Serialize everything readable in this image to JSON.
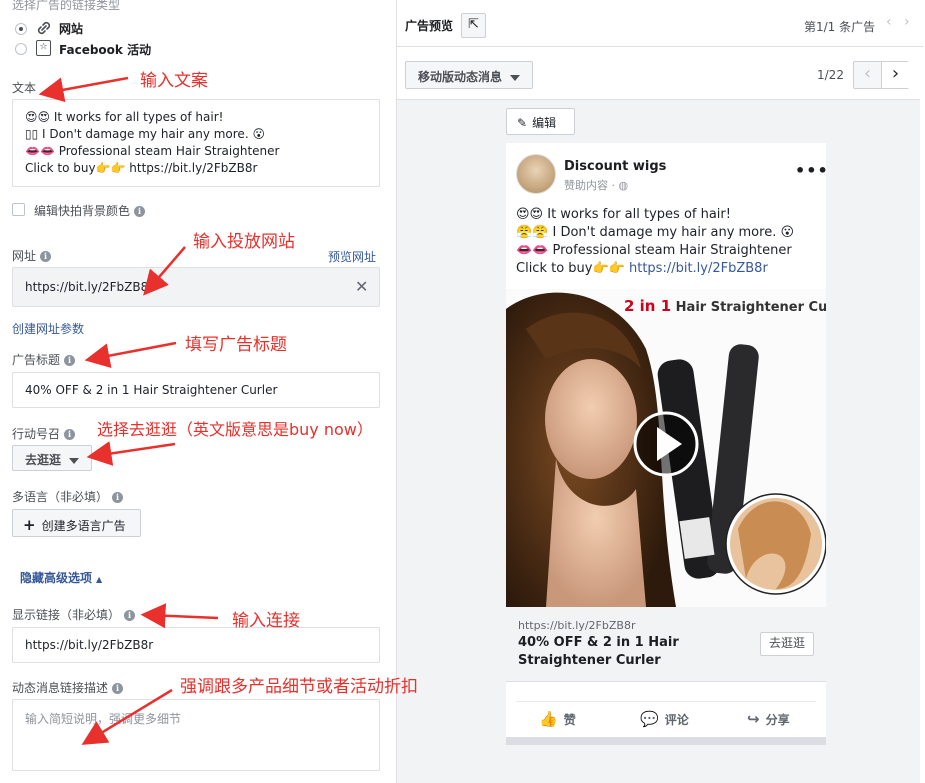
{
  "left": {
    "link_type_label": "选择广告的链接类型",
    "option_website": "网站",
    "option_facebook_event": "Facebook 活动",
    "text_label": "文本",
    "text_lines": [
      "😍😍 It works for all types of hair!",
      "▯▯ I Don't damage my hair any more. 😮",
      "👄👄 Professional steam Hair Straightener",
      "Click to buy👉👉 https://bit.ly/2FbZB8r"
    ],
    "edit_bg_color": "编辑快拍背景颜色",
    "url_label": "网址",
    "preview_url": "预览网址",
    "url_value": "https://bit.ly/2FbZB8r",
    "create_url_params": "创建网址参数",
    "headline_label": "广告标题",
    "headline_value": "40% OFF & 2 in 1 Hair Straightener Curler",
    "cta_label": "行动号召",
    "cta_value": "去逛逛",
    "multilang_label": "多语言（非必填）",
    "create_multilang": "创建多语言广告",
    "hide_advanced": "隐藏高级选项",
    "display_link_label": "显示链接（非必填）",
    "display_link_value": "https://bit.ly/2FbZB8r",
    "news_desc_label": "动态消息链接描述",
    "news_desc_placeholder": "输入简短说明，强调更多细节"
  },
  "annotations": {
    "a1": "输入文案",
    "a2": "输入投放网站",
    "a3": "填写广告标题",
    "a4": "选择去逛逛（英文版意思是buy now）",
    "a5": "输入连接",
    "a6": "强调跟多产品细节或者活动折扣"
  },
  "preview": {
    "title": "广告预览",
    "ad_count": "第1/1 条广告",
    "placement": "移动版动态消息",
    "page_indicator": "1/22",
    "edit": "编辑",
    "page_name": "Discount wigs",
    "sponsored": "赞助内容 · ",
    "post_lines": [
      "😍😍 It works for all types of hair!",
      "😤😤 I Don't damage my hair any more. 😮",
      "👄👄 Professional steam Hair Straightener"
    ],
    "post_last_prefix": "Click to buy👉👉 ",
    "post_link": "https://bit.ly/2FbZB8r",
    "image_title_bold": "2 in 1",
    "image_title_rest": " Hair Straightener Curler",
    "link_url": "https://bit.ly/2FbZB8r",
    "link_headline": "40% OFF & 2 in 1 Hair Straightener Curler",
    "link_cta": "去逛逛",
    "like": "赞",
    "comment": "评论",
    "share": "分享"
  },
  "colors": {
    "annotation": "#e8302c",
    "link": "#365899",
    "panel_border": "#dddfe2"
  }
}
